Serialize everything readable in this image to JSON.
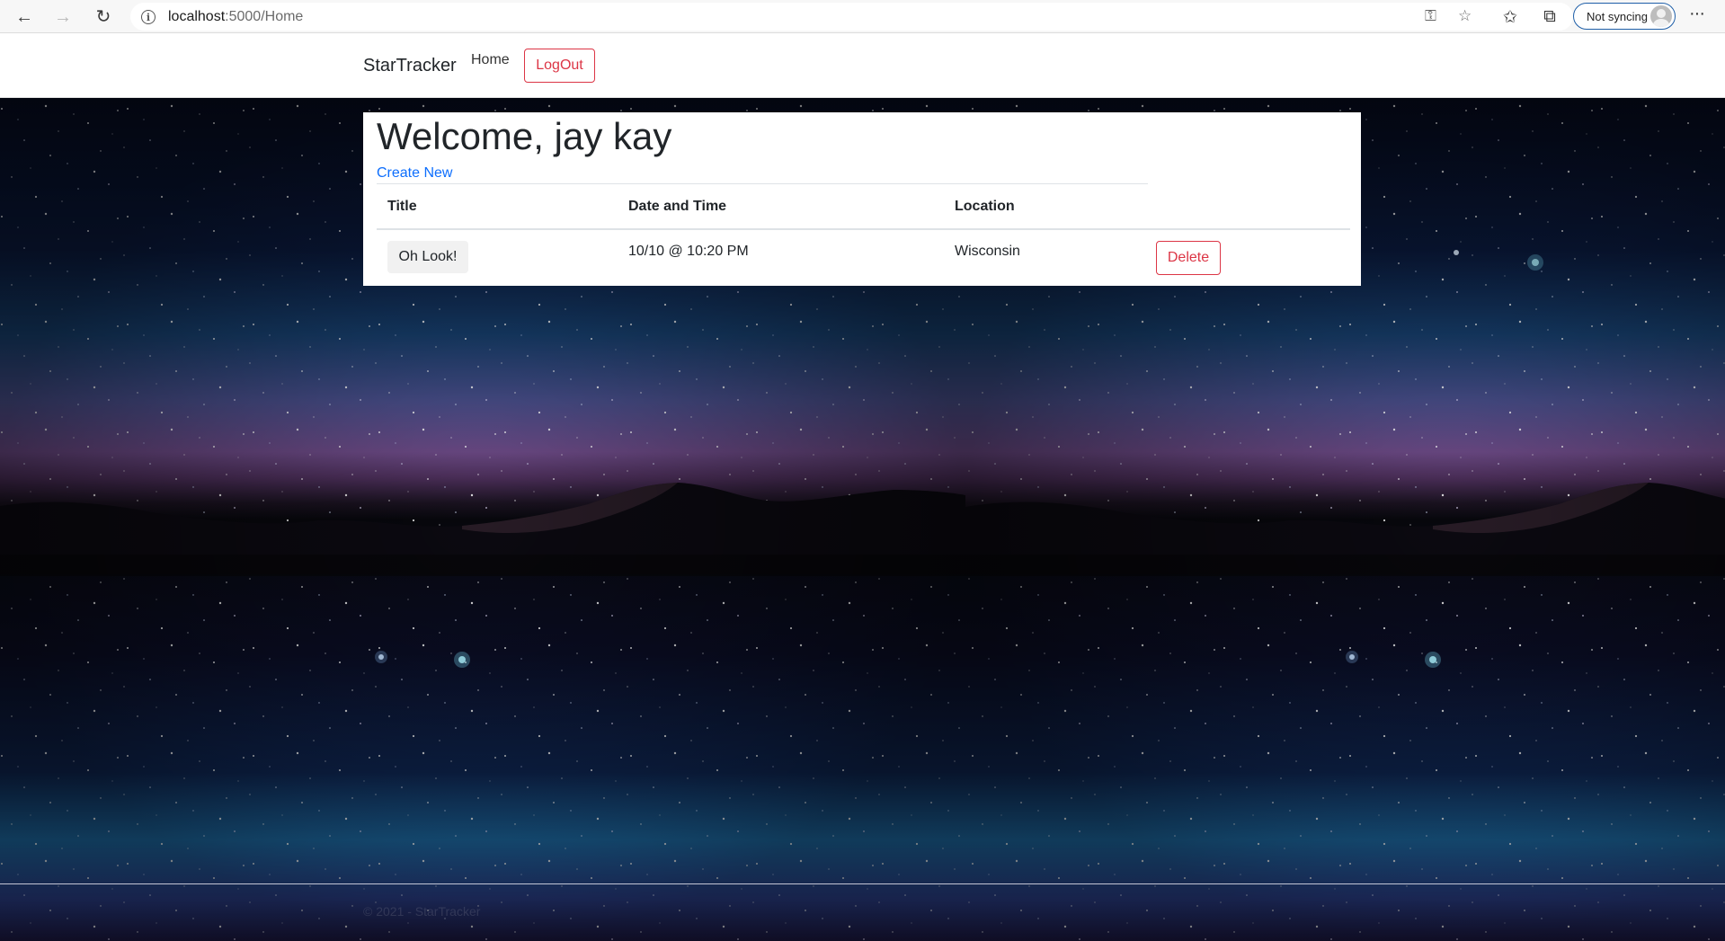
{
  "browser": {
    "url_host": "localhost",
    "url_path": ":5000/Home",
    "profile_label": "Not syncing"
  },
  "navbar": {
    "brand": "StarTracker",
    "home_label": "Home",
    "logout_label": "LogOut"
  },
  "main": {
    "welcome_prefix": "Welcome, ",
    "user_name": "jay kay",
    "create_new_label": "Create New",
    "table": {
      "headers": [
        "Title",
        "Date and Time",
        "Location"
      ],
      "rows": [
        {
          "title": "Oh Look!",
          "datetime": "10/10 @ 10:20 PM",
          "location": "Wisconsin",
          "delete_label": "Delete"
        }
      ]
    }
  },
  "footer": {
    "text": "© 2021 - StarTracker"
  },
  "colors": {
    "danger": "#dc3545",
    "link": "#0d6efd"
  }
}
